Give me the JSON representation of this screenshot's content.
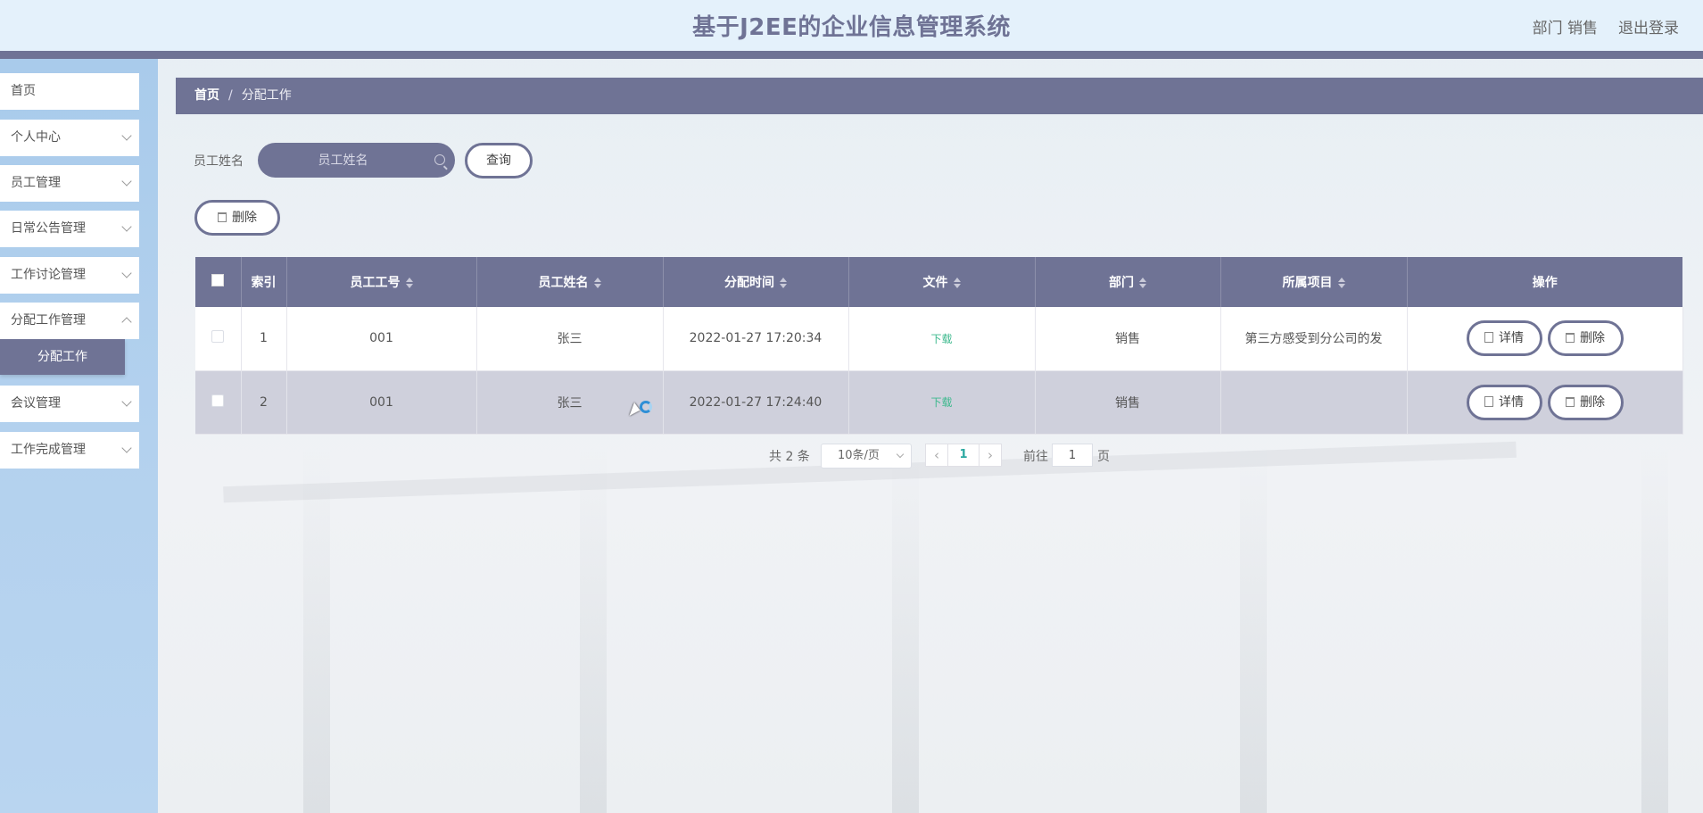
{
  "header": {
    "title": "基于J2EE的企业信息管理系统",
    "user_info": "部门 销售",
    "logout_label": "退出登录"
  },
  "sidebar": {
    "items": [
      {
        "label": "首页"
      },
      {
        "label": "个人中心"
      },
      {
        "label": "员工管理"
      },
      {
        "label": "日常公告管理"
      },
      {
        "label": "工作讨论管理"
      },
      {
        "label": "分配工作管理"
      },
      {
        "label": "会议管理"
      },
      {
        "label": "工作完成管理"
      }
    ],
    "active_sub_item": "分配工作"
  },
  "breadcrumb": {
    "home": "首页",
    "separator": "/",
    "current": "分配工作"
  },
  "search": {
    "label": "员工姓名",
    "placeholder": "员工姓名",
    "query_label": "查询"
  },
  "toolbar": {
    "delete_label": "删除"
  },
  "table": {
    "columns": [
      "索引",
      "员工工号",
      "员工姓名",
      "分配时间",
      "文件",
      "部门",
      "所属项目",
      "操作"
    ],
    "rows": [
      {
        "index": "1",
        "emp_no": "001",
        "emp_name": "张三",
        "time": "2022-01-27 17:20:34",
        "file": "下载",
        "dept": "销售",
        "project": "第三方感受到分公司的发"
      },
      {
        "index": "2",
        "emp_no": "001",
        "emp_name": "张三",
        "time": "2022-01-27 17:24:40",
        "file": "下载",
        "dept": "销售",
        "project": ""
      }
    ],
    "detail_label": "详情",
    "delete_label": "删除"
  },
  "pagination": {
    "total": "共 2 条",
    "page_size": "10条/页",
    "prev": "‹",
    "current_page": "1",
    "next": "›",
    "goto_label": "前往",
    "goto_value": "1",
    "page_unit": "页"
  },
  "colors": {
    "primary": "#6f7395",
    "header_bg": "#e4f1fb",
    "sidebar_bg": "#b3d1ee",
    "link_green": "#3eb98e"
  }
}
